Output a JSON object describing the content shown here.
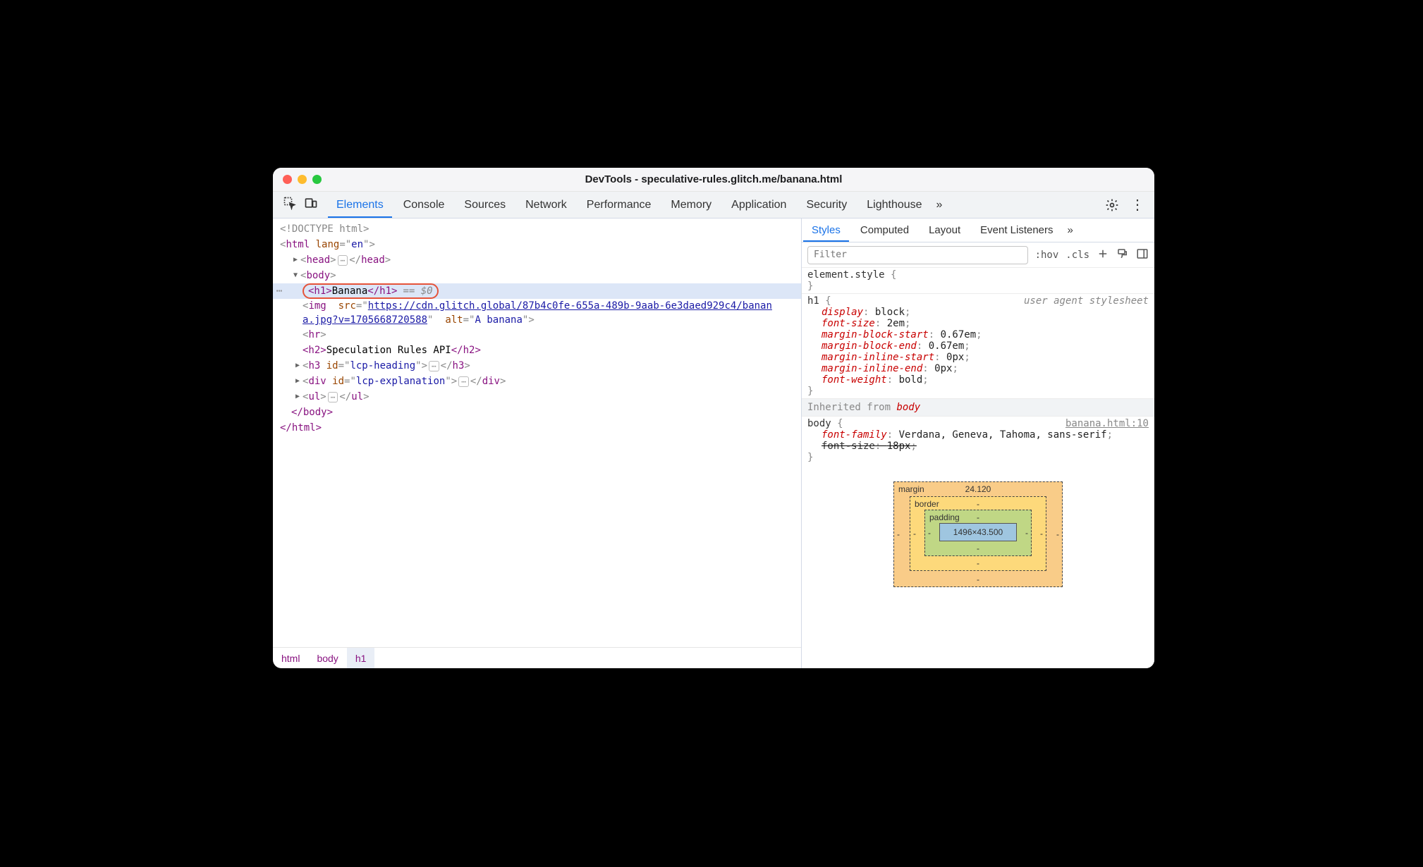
{
  "window": {
    "title": "DevTools - speculative-rules.glitch.me/banana.html"
  },
  "tabs": {
    "items": [
      "Elements",
      "Console",
      "Sources",
      "Network",
      "Performance",
      "Memory",
      "Application",
      "Security",
      "Lighthouse"
    ],
    "active": 0,
    "overflow": "»"
  },
  "dom": {
    "doctype": "<!DOCTYPE html>",
    "html_open": {
      "tag": "html",
      "attrs": [
        {
          "n": "lang",
          "v": "en"
        }
      ]
    },
    "head": {
      "tag": "head"
    },
    "body_open": {
      "tag": "body"
    },
    "h1": {
      "open": "<h1>",
      "text": "Banana",
      "close": "</h1>",
      "eq": "== $0"
    },
    "img": {
      "tag": "img",
      "src_pre": "src=\"",
      "src": "https://cdn.glitch.global/87b4c0fe-655a-489b-9aab-6e3daed929c4/banana.jpg?v=1705668720588",
      "src_post": "\"",
      "alt_pre": " alt=\"",
      "alt": "A banana",
      "alt_post": "\""
    },
    "hr": {
      "tag": "hr"
    },
    "h2": {
      "open": "<h2>",
      "text": "Speculation Rules API",
      "close": "</h2>"
    },
    "h3": {
      "tag": "h3",
      "attrs": [
        {
          "n": "id",
          "v": "lcp-heading"
        }
      ]
    },
    "div": {
      "tag": "div",
      "attrs": [
        {
          "n": "id",
          "v": "lcp-explanation"
        }
      ]
    },
    "ul": {
      "tag": "ul"
    },
    "body_close": "</body>",
    "html_close": "</html>"
  },
  "breadcrumb": [
    "html",
    "body",
    "h1"
  ],
  "side_tabs": {
    "items": [
      "Styles",
      "Computed",
      "Layout",
      "Event Listeners"
    ],
    "active": 0,
    "overflow": "»"
  },
  "filter": {
    "placeholder": "Filter",
    "hov": ":hov",
    "cls": ".cls"
  },
  "styles": {
    "element_style": {
      "sel": "element.style",
      "decls": []
    },
    "h1": {
      "sel": "h1",
      "src": "user agent stylesheet",
      "decls": [
        {
          "p": "display",
          "v": "block"
        },
        {
          "p": "font-size",
          "v": "2em"
        },
        {
          "p": "margin-block-start",
          "v": "0.67em"
        },
        {
          "p": "margin-block-end",
          "v": "0.67em"
        },
        {
          "p": "margin-inline-start",
          "v": "0px"
        },
        {
          "p": "margin-inline-end",
          "v": "0px"
        },
        {
          "p": "font-weight",
          "v": "bold"
        }
      ]
    },
    "inherit_from": "Inherited from",
    "inherit_el": "body",
    "body": {
      "sel": "body",
      "link": "banana.html:10",
      "decls": [
        {
          "p": "font-family",
          "v": "Verdana, Geneva, Tahoma, sans-serif"
        },
        {
          "p": "font-size",
          "v": "18px",
          "strike": true
        }
      ]
    }
  },
  "boxmodel": {
    "margin": {
      "label": "margin",
      "top": "24.120",
      "right": "-",
      "bottom": "-",
      "left": "-"
    },
    "border": {
      "label": "border",
      "top": "-",
      "right": "-",
      "bottom": "-",
      "left": "-"
    },
    "padding": {
      "label": "padding",
      "top": "-",
      "right": "-",
      "bottom": "-",
      "left": "-"
    },
    "content": "1496×43.500"
  }
}
